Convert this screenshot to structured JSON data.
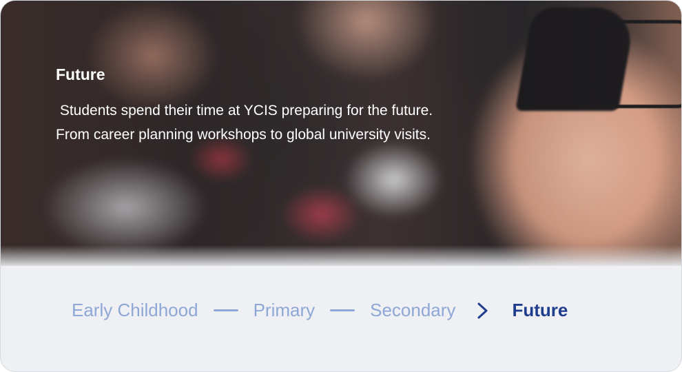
{
  "hero": {
    "title": "Future",
    "description": " Students spend their time at YCIS preparing for the future. From career planning workshops to global university visits."
  },
  "stages": {
    "items": [
      {
        "label": "Early Childhood",
        "active": false
      },
      {
        "label": "Primary",
        "active": false
      },
      {
        "label": "Secondary",
        "active": false
      },
      {
        "label": "Future",
        "active": true
      }
    ]
  },
  "colors": {
    "inactive_stage": "#8fa7d6",
    "active_stage": "#1f3d8c",
    "panel_bg": "#eef0f3"
  },
  "icons": {
    "separator": "dash-line",
    "current_separator": "chevron-right-icon"
  }
}
